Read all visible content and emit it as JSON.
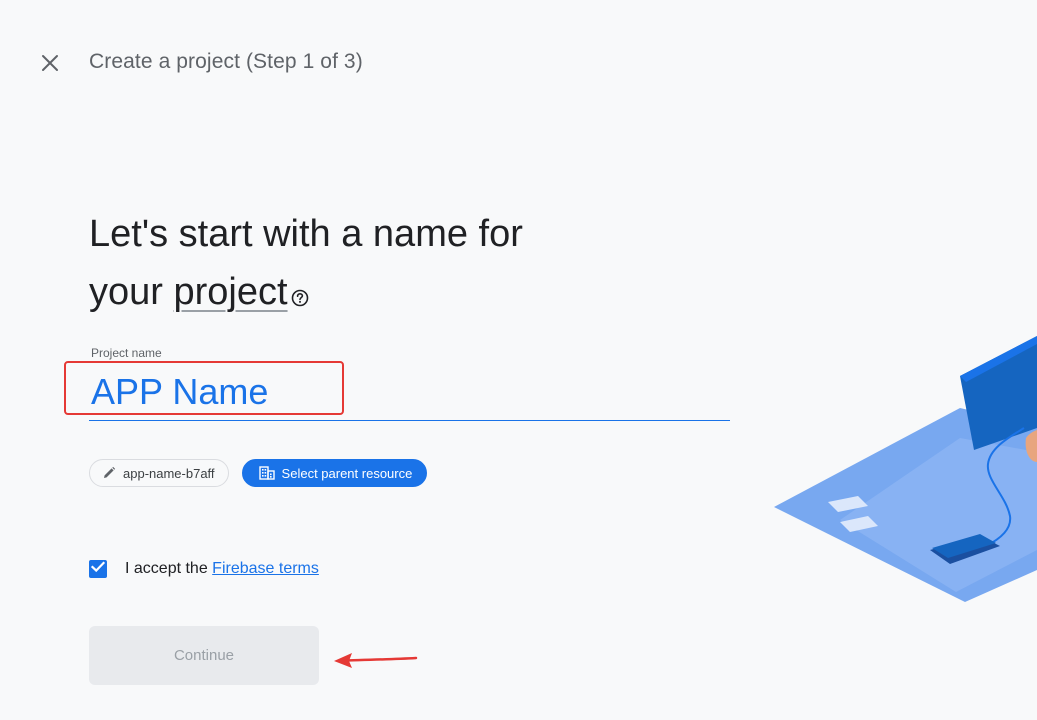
{
  "header": {
    "close_label": "Close",
    "step_title": "Create a project (Step 1 of 3)"
  },
  "main": {
    "heading_line1": "Let's start with a name for",
    "heading_line2_prefix": "your ",
    "heading_line2_link": "project"
  },
  "form": {
    "project_name_label": "Project name",
    "project_name_value": "APP Name"
  },
  "chips": {
    "project_id": "app-name-b7aff",
    "parent_resource": "Select parent resource"
  },
  "terms": {
    "prefix": "I accept the ",
    "link": "Firebase terms",
    "checked": true
  },
  "actions": {
    "continue_label": "Continue"
  },
  "colors": {
    "accent": "#1a73e8",
    "annotation": "#e53935",
    "background": "#f8f9fa"
  }
}
